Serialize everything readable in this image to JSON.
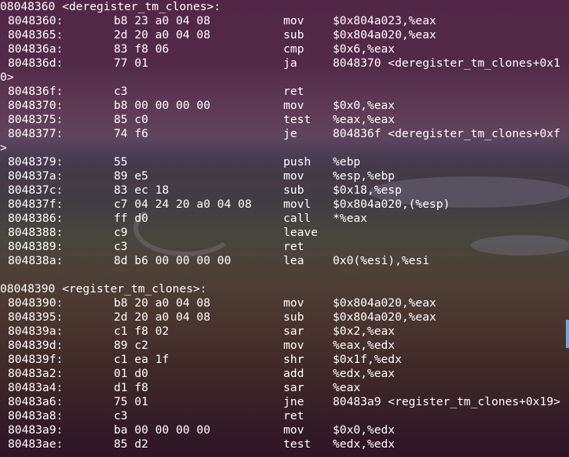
{
  "terminal": {
    "lines": [
      {
        "type": "label",
        "text": "08048360 <deregister_tm_clones>:"
      },
      {
        "type": "ins",
        "addr": "8048360:",
        "bytes": "b8 23 a0 04 08",
        "op": "mov",
        "args": "$0x804a023,%eax"
      },
      {
        "type": "ins",
        "addr": "8048365:",
        "bytes": "2d 20 a0 04 08",
        "op": "sub",
        "args": "$0x804a020,%eax"
      },
      {
        "type": "ins",
        "addr": "804836a:",
        "bytes": "83 f8 06",
        "op": "cmp",
        "args": "$0x6,%eax"
      },
      {
        "type": "ins",
        "addr": "804836d:",
        "bytes": "77 01",
        "op": "ja",
        "args": "8048370 <deregister_tm_clones+0x1"
      },
      {
        "type": "wrap",
        "text": "0>"
      },
      {
        "type": "ins",
        "addr": "804836f:",
        "bytes": "c3",
        "op": "ret",
        "args": ""
      },
      {
        "type": "ins",
        "addr": "8048370:",
        "bytes": "b8 00 00 00 00",
        "op": "mov",
        "args": "$0x0,%eax"
      },
      {
        "type": "ins",
        "addr": "8048375:",
        "bytes": "85 c0",
        "op": "test",
        "args": "%eax,%eax"
      },
      {
        "type": "ins",
        "addr": "8048377:",
        "bytes": "74 f6",
        "op": "je",
        "args": "804836f <deregister_tm_clones+0xf"
      },
      {
        "type": "wrap",
        "text": ">"
      },
      {
        "type": "ins",
        "addr": "8048379:",
        "bytes": "55",
        "op": "push",
        "args": "%ebp"
      },
      {
        "type": "ins",
        "addr": "804837a:",
        "bytes": "89 e5",
        "op": "mov",
        "args": "%esp,%ebp"
      },
      {
        "type": "ins",
        "addr": "804837c:",
        "bytes": "83 ec 18",
        "op": "sub",
        "args": "$0x18,%esp"
      },
      {
        "type": "ins",
        "addr": "804837f:",
        "bytes": "c7 04 24 20 a0 04 08",
        "op": "movl",
        "args": "$0x804a020,(%esp)"
      },
      {
        "type": "ins",
        "addr": "8048386:",
        "bytes": "ff d0",
        "op": "call",
        "args": "*%eax"
      },
      {
        "type": "ins",
        "addr": "8048388:",
        "bytes": "c9",
        "op": "leave",
        "args": ""
      },
      {
        "type": "ins",
        "addr": "8048389:",
        "bytes": "c3",
        "op": "ret",
        "args": ""
      },
      {
        "type": "ins",
        "addr": "804838a:",
        "bytes": "8d b6 00 00 00 00",
        "op": "lea",
        "args": "0x0(%esi),%esi"
      },
      {
        "type": "blank",
        "text": ""
      },
      {
        "type": "label",
        "text": "08048390 <register_tm_clones>:"
      },
      {
        "type": "ins",
        "addr": "8048390:",
        "bytes": "b8 20 a0 04 08",
        "op": "mov",
        "args": "$0x804a020,%eax"
      },
      {
        "type": "ins",
        "addr": "8048395:",
        "bytes": "2d 20 a0 04 08",
        "op": "sub",
        "args": "$0x804a020,%eax"
      },
      {
        "type": "ins",
        "addr": "804839a:",
        "bytes": "c1 f8 02",
        "op": "sar",
        "args": "$0x2,%eax"
      },
      {
        "type": "ins",
        "addr": "804839d:",
        "bytes": "89 c2",
        "op": "mov",
        "args": "%eax,%edx"
      },
      {
        "type": "ins",
        "addr": "804839f:",
        "bytes": "c1 ea 1f",
        "op": "shr",
        "args": "$0x1f,%edx"
      },
      {
        "type": "ins",
        "addr": "80483a2:",
        "bytes": "01 d0",
        "op": "add",
        "args": "%edx,%eax"
      },
      {
        "type": "ins",
        "addr": "80483a4:",
        "bytes": "d1 f8",
        "op": "sar",
        "args": "%eax"
      },
      {
        "type": "ins",
        "addr": "80483a6:",
        "bytes": "75 01",
        "op": "jne",
        "args": "80483a9 <register_tm_clones+0x19>"
      },
      {
        "type": "ins",
        "addr": "80483a8:",
        "bytes": "c3",
        "op": "ret",
        "args": ""
      },
      {
        "type": "ins",
        "addr": "80483a9:",
        "bytes": "ba 00 00 00 00",
        "op": "mov",
        "args": "$0x0,%edx"
      },
      {
        "type": "ins",
        "addr": "80483ae:",
        "bytes": "85 d2",
        "op": "test",
        "args": "%edx,%edx"
      }
    ]
  },
  "colors": {
    "text": "#ffffff",
    "scrollbar_thumb": "#6aa6e6"
  }
}
